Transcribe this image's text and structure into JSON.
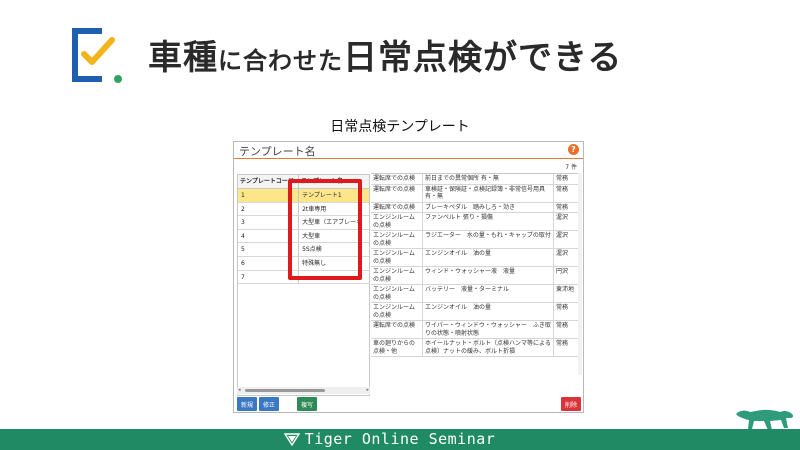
{
  "header": {
    "headline_parts": [
      {
        "text": "車種",
        "size": "big"
      },
      {
        "text": "に合わせた",
        "size": "small"
      },
      {
        "text": "日常点検",
        "size": "big"
      },
      {
        "text": "ができる",
        "size": "big"
      }
    ],
    "subtitle": "日常点検テンプレート"
  },
  "colors": {
    "logo_blue": "#1f5fae",
    "logo_yellow": "#f2b31b",
    "logo_green": "#2ba560",
    "highlight": "#e0191b",
    "footer_green": "#1f8a63"
  },
  "app": {
    "title": "テンプレート名",
    "help_icon": "?",
    "count": "7 件",
    "left_grid": {
      "headers": [
        "テンプレートコード",
        "テンプレート名"
      ],
      "rows": [
        {
          "code": "1",
          "name": "テンプレート1",
          "selected": true
        },
        {
          "code": "2",
          "name": "2t車専用"
        },
        {
          "code": "3",
          "name": "大型車（エアブレーキ"
        },
        {
          "code": "4",
          "name": "大型車"
        },
        {
          "code": "5",
          "name": "5S点検"
        },
        {
          "code": "6",
          "name": "特殊無し"
        },
        {
          "code": "7",
          "name": ""
        }
      ]
    },
    "right_grid": {
      "rows": [
        {
          "cat": "運転席での点検",
          "item": "前日までの異常個所 有・無",
          "who": "常務"
        },
        {
          "cat": "運転席での点検",
          "item": "車検証・保険証・点検記録簿・非常信号用具 有・無",
          "who": "常務"
        },
        {
          "cat": "運転席での点検",
          "item": "ブレーキペダル　踏みしろ・効き",
          "who": "常務"
        },
        {
          "cat": "エンジンルームの点検",
          "item": "ファンベルト 張り・損傷",
          "who": "渥沢"
        },
        {
          "cat": "エンジンルームの点検",
          "item": "ラジエーター　水の量・もれ・キャップの取付",
          "who": "渥沢"
        },
        {
          "cat": "エンジンルームの点検",
          "item": "エンジンオイル　油の量",
          "who": "渥沢"
        },
        {
          "cat": "エンジンルームの点検",
          "item": "ウィンド・ウォッシャー液　液量",
          "who": "円沢"
        },
        {
          "cat": "エンジンルームの点検",
          "item": "バッテリー　液量・ターミナル",
          "who": "東沛地"
        },
        {
          "cat": "エンジンルームの点検",
          "item": "エンジンオイル　油の量",
          "who": "常務"
        },
        {
          "cat": "運転席での点検",
          "item": "ワイパー・ウィンドウ・ウォッシャー　ふき取りの状態・噴射状態",
          "who": "常務"
        },
        {
          "cat": "車の廻りからの点検・他",
          "item": "ホイールナット・ボルト（点検ハンマ等による点検）ナットの緩み、ボルト折損",
          "who": "常務"
        }
      ]
    },
    "buttons": {
      "new": "新規",
      "edit": "修正",
      "copy": "複写",
      "delete": "削除"
    }
  },
  "footer": {
    "text": "Tiger Online Seminar"
  }
}
